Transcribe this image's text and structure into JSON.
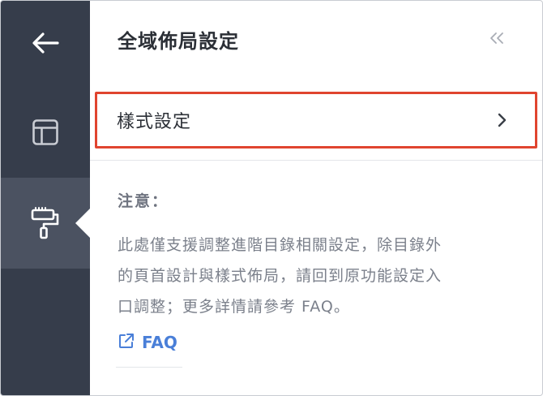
{
  "rail": {
    "items": [
      {
        "name": "back",
        "icon": "arrow-left-icon"
      },
      {
        "name": "layout",
        "icon": "layout-icon"
      },
      {
        "name": "style",
        "icon": "paint-roller-icon",
        "active": true
      }
    ]
  },
  "header": {
    "title": "全域佈局設定",
    "collapse_icon": "double-chevron-left-icon"
  },
  "style_setting": {
    "label": "樣式設定",
    "icon": "chevron-right-icon"
  },
  "note": {
    "title": "注意：",
    "line1": "此處僅支援調整進階目錄相關設定，除目錄外",
    "line2": "的頁首設計與樣式佈局，請回到原功能設定入",
    "line3": "口調整；更多詳情請參考 FAQ。"
  },
  "faq_link": {
    "label": "FAQ",
    "icon": "external-link-icon"
  },
  "colors": {
    "rail_bg": "#363d4b",
    "rail_active": "#4b5261",
    "highlight_border": "#e0442f",
    "link": "#4a7fd8"
  }
}
